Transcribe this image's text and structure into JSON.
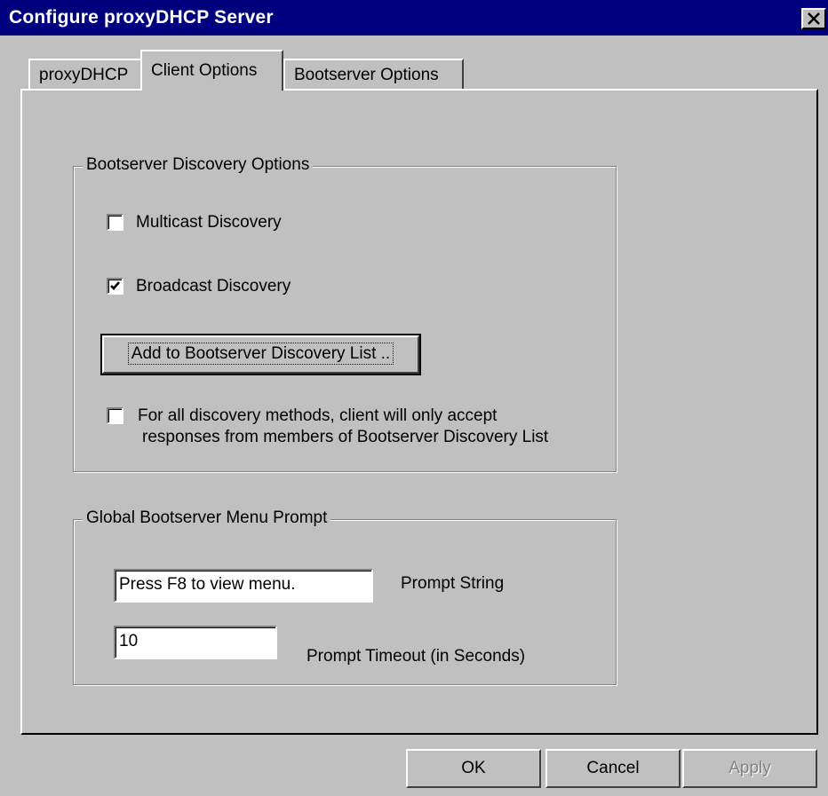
{
  "window": {
    "title": "Configure proxyDHCP Server",
    "close_glyph": "✕"
  },
  "tabs": [
    {
      "label": "proxyDHCP",
      "selected": false
    },
    {
      "label": "Client Options",
      "selected": true
    },
    {
      "label": "Bootserver Options",
      "selected": false
    }
  ],
  "discovery": {
    "legend": "Bootserver Discovery Options",
    "multicast_label": "Multicast Discovery",
    "multicast_checked": false,
    "broadcast_label": "Broadcast Discovery",
    "broadcast_checked": true,
    "add_button_label": "Add to Bootserver Discovery List ..",
    "restrict_label_line1": "For all discovery methods, client will only accept",
    "restrict_label_line2": "responses from members of Bootserver Discovery List",
    "restrict_checked": false
  },
  "menu_prompt": {
    "legend": "Global Bootserver Menu Prompt",
    "prompt_value": "Press F8 to view menu.",
    "prompt_label": "Prompt String",
    "timeout_value": "10",
    "timeout_label": "Prompt Timeout (in Seconds)"
  },
  "buttons": {
    "ok_label": "OK",
    "cancel_label": "Cancel",
    "apply_label": "Apply",
    "apply_enabled": false
  },
  "colors": {
    "titlebar": "#00007f",
    "face": "#c0c0c0"
  },
  "icons": {
    "close": "close-icon",
    "check": "checkmark-icon"
  }
}
